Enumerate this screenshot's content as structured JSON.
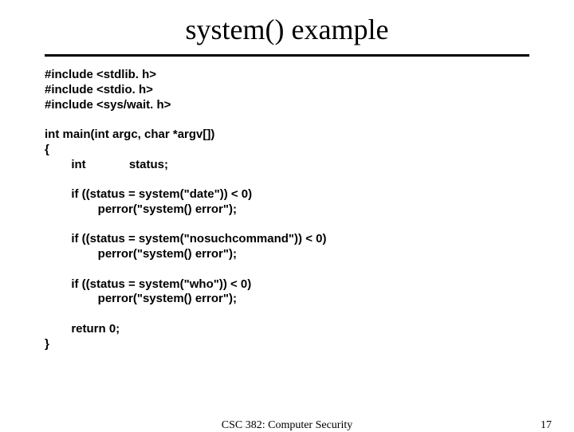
{
  "title": "system() example",
  "code": "#include <stdlib. h>\n#include <stdio. h>\n#include <sys/wait. h>\n\nint main(int argc, char *argv[])\n{\n        int             status;\n\n        if ((status = system(\"date\")) < 0)\n                perror(\"system() error\");\n\n        if ((status = system(\"nosuchcommand\")) < 0)\n                perror(\"system() error\");\n\n        if ((status = system(\"who\")) < 0)\n                perror(\"system() error\");\n\n        return 0;\n}",
  "footer": {
    "course": "CSC 382: Computer Security",
    "page": "17"
  }
}
